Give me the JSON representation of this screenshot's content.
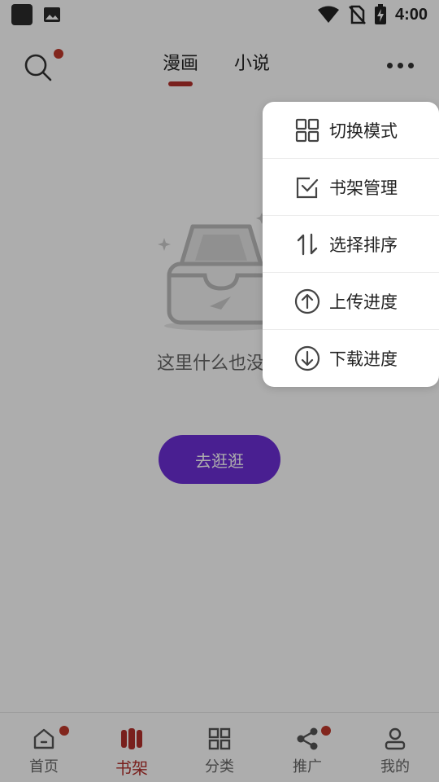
{
  "status_bar": {
    "time": "4:00"
  },
  "header": {
    "tabs": [
      {
        "label": "漫画",
        "active": true
      },
      {
        "label": "小说",
        "active": false
      }
    ]
  },
  "empty_state": {
    "message": "这里什么也没有",
    "button_label": "去逛逛"
  },
  "menu": {
    "items": [
      {
        "label": "切换模式",
        "icon": "grid-icon"
      },
      {
        "label": "书架管理",
        "icon": "checkbox-icon"
      },
      {
        "label": "选择排序",
        "icon": "sort-icon"
      },
      {
        "label": "上传进度",
        "icon": "upload-icon"
      },
      {
        "label": "下载进度",
        "icon": "download-icon"
      }
    ]
  },
  "bottom_nav": {
    "items": [
      {
        "label": "首页",
        "icon": "home-icon",
        "badge": true
      },
      {
        "label": "书架",
        "icon": "bookshelf-icon",
        "active": true
      },
      {
        "label": "分类",
        "icon": "category-icon"
      },
      {
        "label": "推广",
        "icon": "share-icon",
        "badge": true
      },
      {
        "label": "我的",
        "icon": "profile-icon"
      }
    ]
  },
  "colors": {
    "accent": "#b3302b",
    "button": "#6c2fd6",
    "badge": "#c0392b"
  }
}
